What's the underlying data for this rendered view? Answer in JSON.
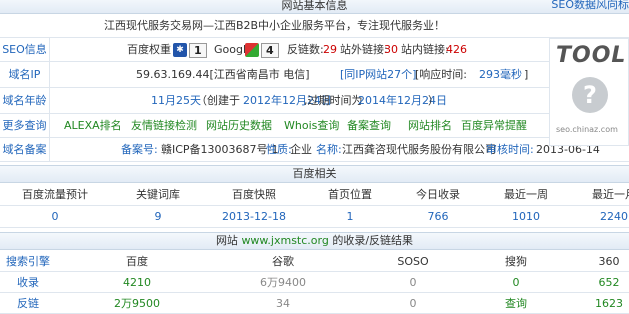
{
  "top": {
    "title": "网站基本信息",
    "link": "SEO数据风向标"
  },
  "site_title": "江西现代服务交易网—江西B2B中小企业服务平台，专注现代服务业！",
  "seo": {
    "label": "SEO信息",
    "baidu_label": "百度权重",
    "baidu_value": "1",
    "google_label": "Google",
    "google_value": "4",
    "backlinks_label": "反链数:",
    "backlinks_value": "29",
    "outlinks_label": "站外链接:",
    "outlinks_value": "30",
    "inlinks_label": "站内链接:",
    "inlinks_value": "426"
  },
  "ip": {
    "label": "域名IP",
    "value": "59.63.169.44[江西省南昌市 电信]",
    "same_ip": "[同IP网站27个]",
    "resp_prefix": "[响应时间:",
    "resp_value": "293毫秒",
    "resp_suffix": "]"
  },
  "age": {
    "label": "域名年龄",
    "value": "11月25天",
    "p1": "（创建于",
    "created": "2012年12月24日",
    "p2": ",过期时间为",
    "expires": "2014年12月24日",
    "p3": "）"
  },
  "more": {
    "label": "更多查询",
    "links": [
      "ALEXA排名",
      "友情链接检测",
      "网站历史数据",
      "Whois查询",
      "备案查询",
      "网站排名",
      "百度异常提醒"
    ]
  },
  "icp": {
    "label": "域名备案",
    "no_label": "备案号:",
    "no_value": "赣ICP备13003687号-1",
    "nature_label": "性质:",
    "nature_value": "企业",
    "name_label": "名称:",
    "name_value": "江西龚咨现代服务股份有限公司",
    "date_label": "审核时间:",
    "date_value": "2013-06-14"
  },
  "logo": {
    "text": "TOOL",
    "url": "seo.chinaz.com"
  },
  "baidu": {
    "title": "百度相关",
    "headers": [
      "百度流量预计",
      "关键词库",
      "百度快照",
      "首页位置",
      "今日收录",
      "最近一周",
      "最近一月"
    ],
    "values": [
      "0",
      "9",
      "2013-12-18",
      "1",
      "766",
      "1010",
      "2240"
    ]
  },
  "index": {
    "title_prefix": "网站",
    "title_url": "www.jxmstc.org",
    "title_suffix": "的收录/反链结果",
    "headers": [
      "搜索引擎",
      "百度",
      "谷歌",
      "SOSO",
      "搜狗",
      "360"
    ],
    "rows": [
      {
        "label": "收录",
        "values": [
          "4210",
          "6万9400",
          "0",
          "0",
          "652"
        ]
      },
      {
        "label": "反链",
        "values": [
          "2万9500",
          "34",
          "0",
          "查询",
          "1623"
        ]
      }
    ]
  },
  "colors": {
    "accent": "#2266bb",
    "red": "#cc0000",
    "green": "#228822",
    "header_bg": "#e2ebf5"
  }
}
